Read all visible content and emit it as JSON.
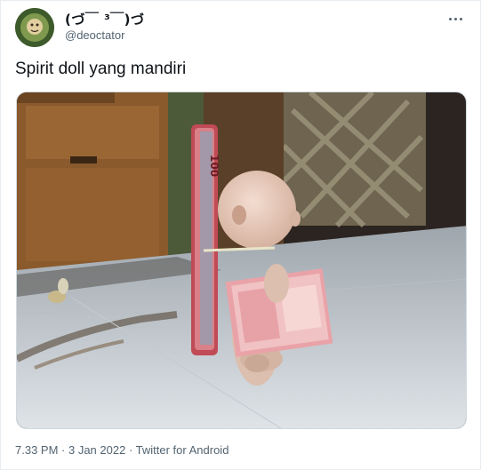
{
  "author": {
    "display_name": "(づ￣ ³￣)づ",
    "handle": "@deoctator"
  },
  "tweet": {
    "text": "Spirit doll yang mandiri"
  },
  "media": {
    "description_icon": "photo-image",
    "banknote_label": "100"
  },
  "meta": {
    "time": "7.33 PM",
    "separator": " · ",
    "date": "3 Jan 2022",
    "app": "Twitter for Android"
  },
  "icons": {
    "more": "more-horizontal-icon"
  },
  "colors": {
    "text_primary": "#0f1419",
    "text_secondary": "#536471",
    "border": "#cfd9de"
  }
}
